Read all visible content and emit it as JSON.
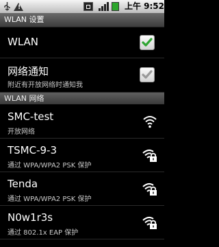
{
  "status_bar": {
    "time": "上午 9:52",
    "icons": [
      "usb-icon",
      "warning-icon",
      "sim-icon",
      "signal-icon",
      "battery-icon"
    ]
  },
  "title_bar": {
    "title": "WLAN 设置"
  },
  "settings": {
    "wlan": {
      "label": "WLAN",
      "checked": true
    },
    "network_notify": {
      "label": "网络通知",
      "summary": "附近有开放网络时通知我",
      "checked": true,
      "enabled": false
    }
  },
  "section_header": {
    "label": "WLAN 网络"
  },
  "networks": [
    {
      "ssid": "SMC-test",
      "security": "开放网络",
      "locked": false,
      "icon": "wifi-open-icon"
    },
    {
      "ssid": "TSMC-9-3",
      "security": "通过 WPA/WPA2 PSK 保护",
      "locked": true,
      "icon": "wifi-lock-icon"
    },
    {
      "ssid": "Tenda",
      "security": "通过 WPA/WPA2 PSK 保护",
      "locked": true,
      "icon": "wifi-lock-icon"
    },
    {
      "ssid": "N0w1r3s",
      "security": "通过 802.1x EAP 保护",
      "locked": true,
      "icon": "wifi-lock-icon"
    }
  ],
  "colors": {
    "check_green": "#2fa532",
    "check_disabled": "#9a9a9a"
  }
}
